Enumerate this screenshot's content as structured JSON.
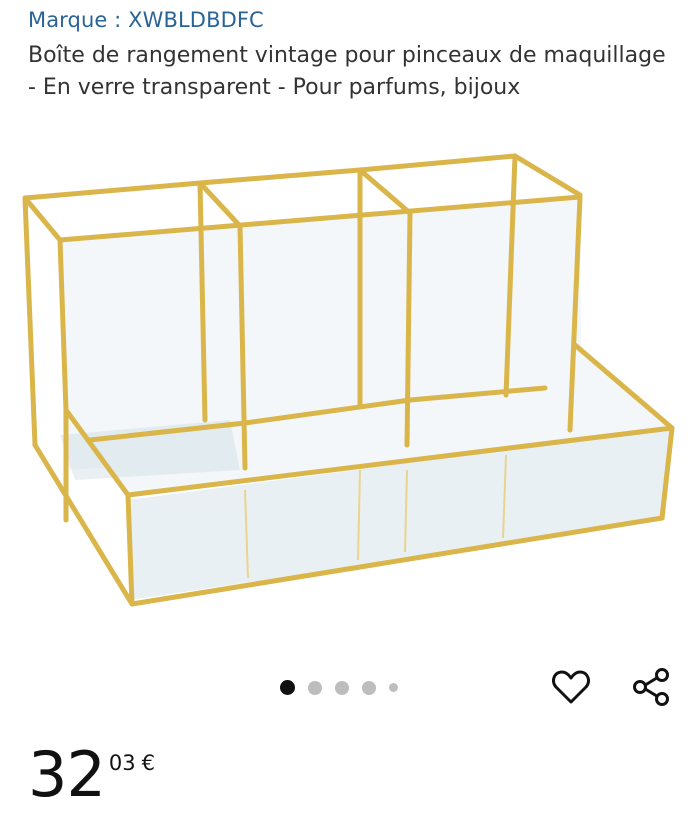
{
  "product": {
    "brand_text": "Marque : XWBLDBDFC",
    "title": "Boîte de rangement vintage pour pinceaux de maquillage - En verre transparent - Pour parfums, bijoux"
  },
  "gallery": {
    "image_count": 5,
    "active_index": 0
  },
  "actions": {
    "favorite_icon": "heart-outline-icon",
    "share_icon": "share-icon"
  },
  "price": {
    "whole": "32",
    "cents": "03",
    "currency": "€"
  },
  "colors": {
    "brand_link": "#2a6496",
    "gold_frame": "#d9b54a",
    "text": "#333333"
  }
}
